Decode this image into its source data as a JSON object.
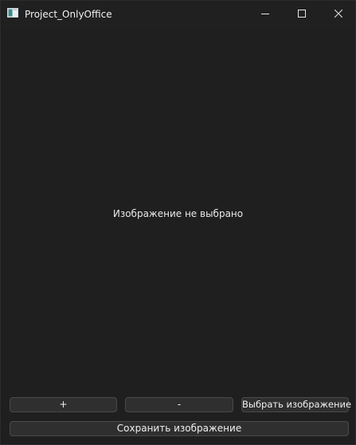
{
  "window": {
    "title": "Project_OnlyOffice",
    "app_icon": "app-window-icon",
    "controls": {
      "minimize": "minimize-icon",
      "maximize": "maximize-icon",
      "close": "close-icon"
    }
  },
  "main": {
    "placeholder_text": "Изображение не выбрано"
  },
  "toolbar": {
    "zoom_in_label": "+",
    "zoom_out_label": "-",
    "choose_image_label": "Выбрать изображение",
    "save_image_label": "Сохранить изображение"
  }
}
